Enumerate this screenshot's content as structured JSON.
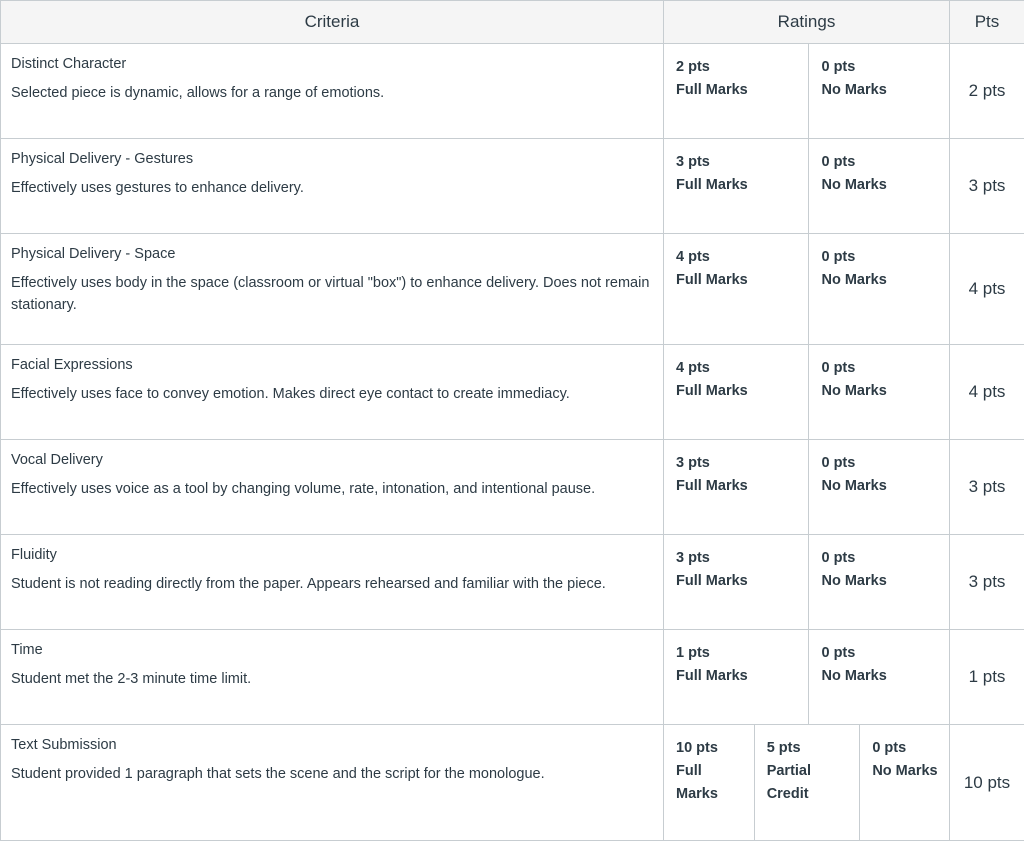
{
  "header": {
    "criteria": "Criteria",
    "ratings": "Ratings",
    "pts": "Pts"
  },
  "rows": [
    {
      "title": "Distinct Character",
      "desc": "Selected piece is dynamic, allows for a range of emotions.",
      "ratings": [
        {
          "pts": "2 pts",
          "desc": "Full Marks"
        },
        {
          "pts": "0 pts",
          "desc": "No Marks"
        }
      ],
      "points": "2 pts"
    },
    {
      "title": "Physical Delivery - Gestures",
      "desc": "Effectively uses gestures to enhance delivery.",
      "ratings": [
        {
          "pts": "3 pts",
          "desc": "Full Marks"
        },
        {
          "pts": "0 pts",
          "desc": "No Marks"
        }
      ],
      "points": "3 pts"
    },
    {
      "title": "Physical Delivery - Space",
      "desc": "Effectively uses body in the space (classroom or virtual \"box\") to enhance delivery. Does not remain stationary.",
      "ratings": [
        {
          "pts": "4 pts",
          "desc": "Full Marks"
        },
        {
          "pts": "0 pts",
          "desc": "No Marks"
        }
      ],
      "points": "4 pts"
    },
    {
      "title": "Facial Expressions",
      "desc": "Effectively uses face to convey emotion. Makes direct eye contact to create immediacy.",
      "ratings": [
        {
          "pts": "4 pts",
          "desc": "Full Marks"
        },
        {
          "pts": "0 pts",
          "desc": "No Marks"
        }
      ],
      "points": "4 pts"
    },
    {
      "title": "Vocal Delivery",
      "desc": "Effectively uses voice as a tool by changing volume, rate, intonation, and intentional pause.",
      "ratings": [
        {
          "pts": "3 pts",
          "desc": "Full Marks"
        },
        {
          "pts": "0 pts",
          "desc": "No Marks"
        }
      ],
      "points": "3 pts"
    },
    {
      "title": "Fluidity",
      "desc": "Student is not reading directly from the paper. Appears rehearsed and familiar with the piece.",
      "ratings": [
        {
          "pts": "3 pts",
          "desc": "Full Marks"
        },
        {
          "pts": "0 pts",
          "desc": "No Marks"
        }
      ],
      "points": "3 pts"
    },
    {
      "title": "Time",
      "desc": "Student met the 2-3 minute time limit.",
      "ratings": [
        {
          "pts": "1 pts",
          "desc": "Full Marks"
        },
        {
          "pts": "0 pts",
          "desc": "No Marks"
        }
      ],
      "points": "1 pts"
    },
    {
      "title": "Text Submission",
      "desc": "Student provided 1 paragraph that sets the scene and the script for the monologue.",
      "ratings": [
        {
          "pts": "10 pts",
          "desc": "Full Marks"
        },
        {
          "pts": "5 pts",
          "desc": "Partial Credit"
        },
        {
          "pts": "0 pts",
          "desc": "No Marks"
        }
      ],
      "points": "10 pts"
    }
  ]
}
